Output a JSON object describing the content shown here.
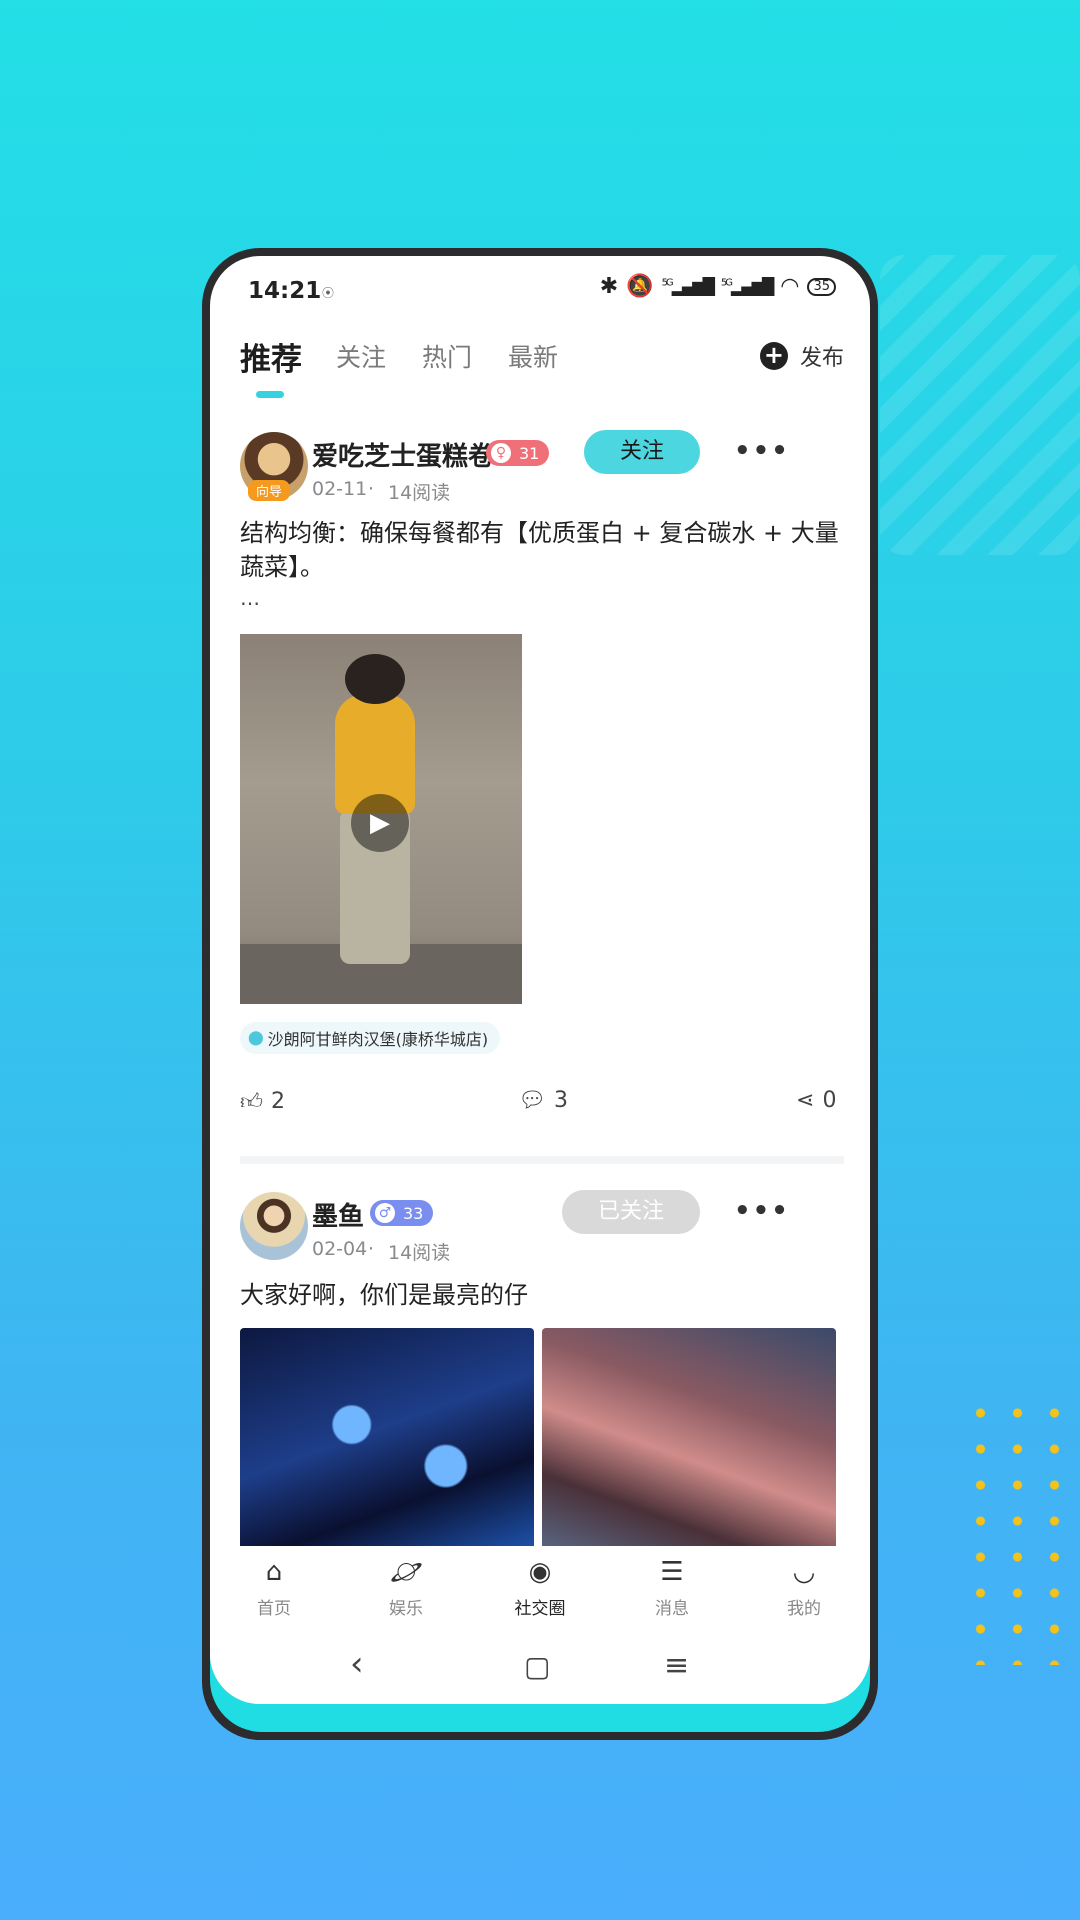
{
  "status": {
    "time": "14:21",
    "signal1": "5G",
    "signal2": "5G",
    "battery": "35"
  },
  "tabs": [
    "推荐",
    "关注",
    "热门",
    "最新"
  ],
  "publish_label": "发布",
  "post1": {
    "username": "爱吃芝士蛋糕卷",
    "avatar_badge": "向导",
    "gender": "female",
    "level": "31",
    "date": "02-11",
    "reads": "14阅读",
    "follow_label": "关注",
    "content": "结构均衡：确保每餐都有【优质蛋白 + 复合碳水 + 大量蔬菜】。",
    "ellipsis": "…",
    "location": "沙朗阿甘鲜肉汉堡(康桥华城店)",
    "likes": "2",
    "comments": "3",
    "shares": "0"
  },
  "post2": {
    "username": "墨鱼",
    "gender": "male",
    "level": "33",
    "date": "02-04",
    "reads": "14阅读",
    "follow_label": "已关注",
    "content": "大家好啊，你们是最亮的仔"
  },
  "bottom_nav": [
    "首页",
    "娱乐",
    "社交圈",
    "消息",
    "我的"
  ],
  "colors": {
    "accent": "#4cd6e0",
    "female": "#f0707a",
    "male": "#7a8ef0",
    "guide_badge": "#f59a1e"
  }
}
